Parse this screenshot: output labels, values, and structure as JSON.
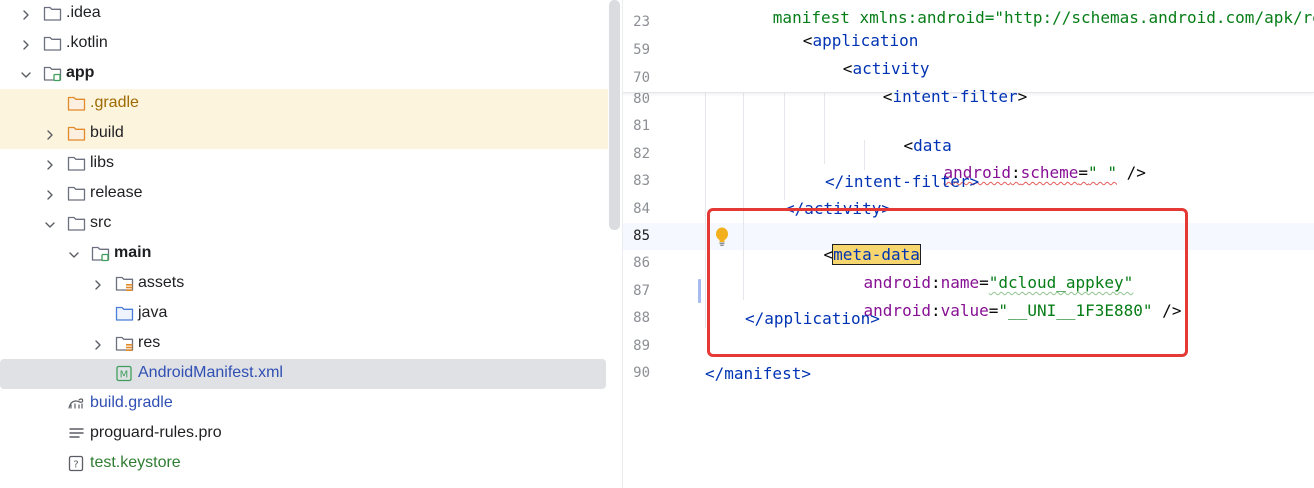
{
  "tree": {
    "items": [
      {
        "label": ".idea",
        "indent": 0,
        "expander": "collapsed",
        "icon": "folder-icon"
      },
      {
        "label": ".kotlin",
        "indent": 0,
        "expander": "collapsed",
        "icon": "folder-icon"
      },
      {
        "label": "app",
        "indent": 0,
        "expander": "expanded",
        "icon": "module-folder-icon"
      },
      {
        "label": ".gradle",
        "indent": 1,
        "expander": "none",
        "icon": "excluded-folder-icon"
      },
      {
        "label": "build",
        "indent": 1,
        "expander": "collapsed",
        "icon": "excluded-folder-icon"
      },
      {
        "label": "libs",
        "indent": 1,
        "expander": "collapsed",
        "icon": "folder-icon"
      },
      {
        "label": "release",
        "indent": 1,
        "expander": "collapsed",
        "icon": "folder-icon"
      },
      {
        "label": "src",
        "indent": 1,
        "expander": "expanded",
        "icon": "folder-icon"
      },
      {
        "label": "main",
        "indent": 2,
        "expander": "expanded",
        "icon": "module-folder-icon"
      },
      {
        "label": "assets",
        "indent": 3,
        "expander": "collapsed",
        "icon": "resource-folder-icon"
      },
      {
        "label": "java",
        "indent": 3,
        "expander": "none",
        "icon": "source-folder-icon"
      },
      {
        "label": "res",
        "indent": 3,
        "expander": "collapsed",
        "icon": "resource-folder-icon"
      },
      {
        "label": "AndroidManifest.xml",
        "indent": 3,
        "expander": "none",
        "icon": "manifest-icon"
      },
      {
        "label": "build.gradle",
        "indent": 1,
        "expander": "none",
        "icon": "gradle-icon"
      },
      {
        "label": "proguard-rules.pro",
        "indent": 1,
        "expander": "none",
        "icon": "text-file-icon"
      },
      {
        "label": "test.keystore",
        "indent": 1,
        "expander": "none",
        "icon": "unknown-file-icon"
      }
    ]
  },
  "editor": {
    "sticky_top_partial": "manifest xmlns:android=\"http://schemas.android.com/apk/res/a",
    "sticky": [
      {
        "num": "23",
        "open": "<",
        "tag": "application",
        "close": ""
      },
      {
        "num": "59",
        "open": "<",
        "tag": "activity",
        "close": ""
      },
      {
        "num": "70",
        "open": "<",
        "tag": "intent-filter",
        "close": ">"
      }
    ],
    "line_numbers": [
      "80",
      "81",
      "82",
      "83",
      "84",
      "85",
      "86",
      "87",
      "88",
      "89",
      "90"
    ],
    "line81": {
      "open": "<",
      "tag": "data"
    },
    "line82": {
      "ns": "android",
      "colon": ":",
      "attr": "scheme",
      "eq": "=",
      "val": "\" \"",
      "end": " />"
    },
    "line83": {
      "text": "</intent-filter>"
    },
    "line84": {
      "text": "</activity>"
    },
    "line85": {
      "open": "<",
      "tag": "meta-data"
    },
    "line86": {
      "ns": "android",
      "colon": ":",
      "attr": "name",
      "eq": "=",
      "val": "\"dcloud_appkey\""
    },
    "line87": {
      "ns": "android",
      "colon": ":",
      "attr": "value",
      "eq": "=",
      "val": "\"__UNI__1F3E880\"",
      "end": " />"
    },
    "line88": {
      "text": "</application>"
    },
    "line90": {
      "text": "</manifest>"
    }
  },
  "colors": {
    "tag": "#0033b3",
    "attribute": "#871094",
    "value": "#067d17",
    "highlight_row": "#fdf4dd",
    "selected_row": "#dfe1e5",
    "annotation_box": "#e53935"
  }
}
